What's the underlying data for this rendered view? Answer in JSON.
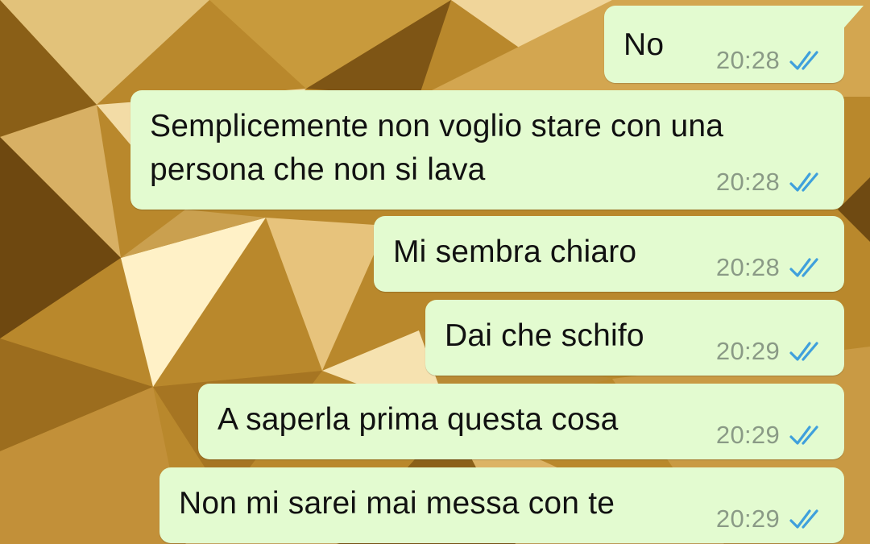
{
  "theme": {
    "bubble_color": "#e3fbd0",
    "tick_color": "#3fa0dc",
    "time_color": "#8a9a86",
    "wallpaper": "gold-polygon"
  },
  "messages": [
    {
      "text": "No",
      "time": "20:28",
      "status_icon": "double-check-read-icon"
    },
    {
      "text": "Semplicemente non voglio stare con una persona che non si lava",
      "time": "20:28",
      "status_icon": "double-check-read-icon"
    },
    {
      "text": "Mi sembra chiaro",
      "time": "20:28",
      "status_icon": "double-check-read-icon"
    },
    {
      "text": "Dai che schifo",
      "time": "20:29",
      "status_icon": "double-check-read-icon"
    },
    {
      "text": "A saperla prima questa cosa",
      "time": "20:29",
      "status_icon": "double-check-read-icon"
    },
    {
      "text": "Non mi sarei mai messa con te",
      "time": "20:29",
      "status_icon": "double-check-read-icon"
    }
  ]
}
